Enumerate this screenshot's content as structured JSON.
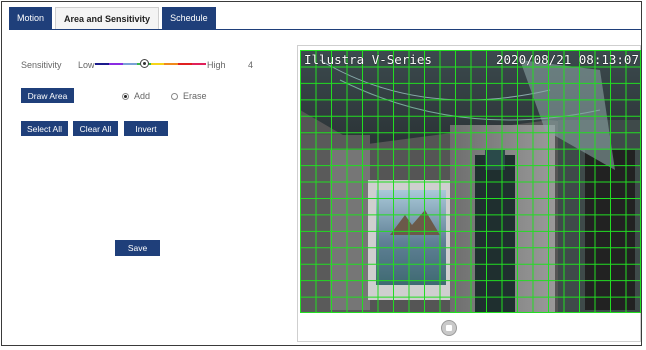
{
  "tabs": [
    {
      "label": "Motion",
      "active": false
    },
    {
      "label": "Area and Sensitivity",
      "active": true
    },
    {
      "label": "Schedule",
      "active": false
    }
  ],
  "sensitivity": {
    "label": "Sensitivity",
    "low_label": "Low",
    "high_label": "High",
    "value": "4",
    "slider_fraction": 0.45,
    "colors": [
      "#1a1a8c",
      "#8a2be2",
      "#7aa0d6",
      "#39b54a",
      "#f7d417",
      "#f08a1c",
      "#e02020",
      "#e0205a"
    ]
  },
  "draw_area_button": "Draw Area",
  "mode": {
    "add_label": "Add",
    "erase_label": "Erase",
    "selected": "add"
  },
  "buttons": {
    "select_all": "Select All",
    "clear_all": "Clear All",
    "invert": "Invert",
    "save": "Save"
  },
  "video": {
    "camera_name": "Illustra V-Series",
    "timestamp": "2020/08/21 08:13:07",
    "grid_columns": 22,
    "grid_rows": 16,
    "grid_color": "#22dd22"
  },
  "colors": {
    "brand_blue": "#1f3f7a"
  }
}
